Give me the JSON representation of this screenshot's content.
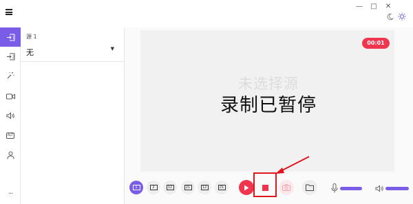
{
  "titlebar": {
    "minimize_glyph": "—",
    "maximize_glyph": "□",
    "close_glyph": "✕"
  },
  "sidebar": {
    "items": [
      {
        "name": "source-1",
        "icon": "input-1-icon",
        "label": "1",
        "active": true
      },
      {
        "name": "source-2",
        "icon": "input-2-icon",
        "label": "2"
      },
      {
        "name": "effects",
        "icon": "magic-wand-icon"
      },
      {
        "name": "camera",
        "icon": "camera-icon"
      },
      {
        "name": "audio",
        "icon": "speaker-icon"
      },
      {
        "name": "alt",
        "icon": "alt-icon",
        "label": "ALT"
      },
      {
        "name": "account",
        "icon": "person-icon"
      }
    ],
    "more_label": "···"
  },
  "source_panel": {
    "label": "源 1",
    "selected": "无"
  },
  "preview": {
    "timer": "00:01",
    "no_source_text": "未选择源",
    "status_text": "录制已暂停"
  },
  "toolbar": {
    "layouts": [
      {
        "label": "1",
        "active": true
      },
      {
        "label": "2"
      },
      {
        "label": "12"
      },
      {
        "label": "21"
      },
      {
        "label": "12"
      },
      {
        "label": "21"
      }
    ]
  },
  "colors": {
    "accent": "#7b5ce6",
    "record_red": "#f0364f",
    "annotation_red": "#e0141c"
  }
}
